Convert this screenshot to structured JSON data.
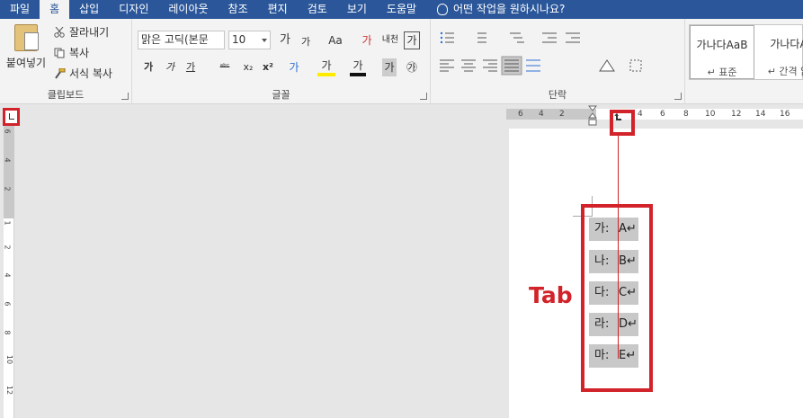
{
  "tabs": [
    "파일",
    "홈",
    "삽입",
    "디자인",
    "레이아웃",
    "참조",
    "편지",
    "검토",
    "보기",
    "도움말"
  ],
  "active_tab": "홈",
  "tell_me": "어떤 작업을 원하시나요?",
  "clipboard": {
    "paste": "붙여넣기",
    "cut": "잘라내기",
    "copy": "복사",
    "format_painter": "서식 복사",
    "label": "클립보드"
  },
  "font": {
    "font_name": "맑은 고딕(본문",
    "font_size": "10",
    "grow": "가",
    "shrink": "가",
    "change_case": "Aa",
    "clear_format": "가",
    "phonetic": "내천",
    "char_border": "가",
    "bold": "가",
    "italic": "가",
    "underline": "가",
    "strike": "ᵃᵇᶜ",
    "subscript": "x₂",
    "superscript": "x²",
    "text_effect": "가",
    "highlight": "가",
    "font_color": "가",
    "char_shade": "가",
    "enclosed": "㉮",
    "label": "글꼴"
  },
  "paragraph": {
    "label": "단락"
  },
  "styles": [
    {
      "preview": "가나다AaB",
      "name": "↵ 표준"
    },
    {
      "preview": "가나다A",
      "name": "↵ 간격 없"
    }
  ],
  "hruler_numbers": [
    "6",
    "4",
    "2",
    "2",
    "4",
    "6",
    "8",
    "10",
    "12",
    "14",
    "16"
  ],
  "vruler_numbers": [
    "6",
    "4",
    "2",
    "1",
    "2",
    "4",
    "6",
    "8",
    "10",
    "12"
  ],
  "rows": [
    {
      "key": "가:",
      "val": "A↵"
    },
    {
      "key": "나:",
      "val": "B↵"
    },
    {
      "key": "다:",
      "val": "C↵"
    },
    {
      "key": "라:",
      "val": "D↵"
    },
    {
      "key": "마:",
      "val": "E↵"
    }
  ],
  "caption": "Tab",
  "colors": {
    "accent": "#2b579a",
    "annotation": "#d2232a",
    "ribbon": "#f3f3f3"
  }
}
